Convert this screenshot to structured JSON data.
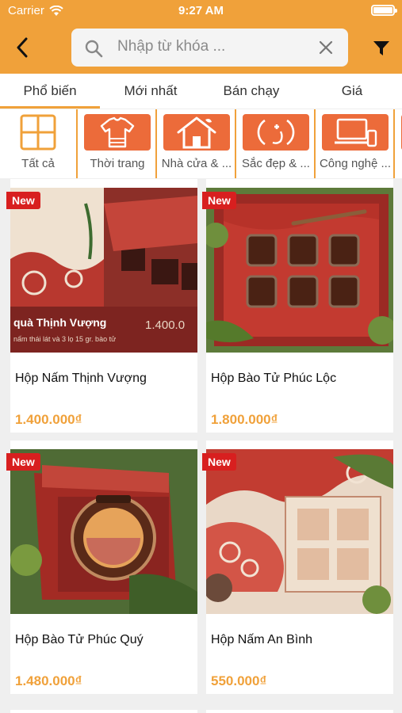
{
  "status_bar": {
    "carrier": "Carrier",
    "time": "9:27 AM"
  },
  "header": {
    "search_placeholder": "Nhập từ khóa ...",
    "accent": "#f0a13a"
  },
  "tabs": [
    {
      "label": "Phổ biến",
      "active": true
    },
    {
      "label": "Mới nhất",
      "active": false
    },
    {
      "label": "Bán chạy",
      "active": false
    },
    {
      "label": "Giá",
      "active": false
    }
  ],
  "categories": [
    {
      "label": "Tất cả",
      "icon": "grid-icon"
    },
    {
      "label": "Thời trang",
      "icon": "shirt-icon"
    },
    {
      "label": "Nhà cửa & ...",
      "icon": "house-icon"
    },
    {
      "label": "Sắc đẹp & ...",
      "icon": "beauty-icon"
    },
    {
      "label": "Công nghệ ...",
      "icon": "devices-icon"
    }
  ],
  "products": [
    {
      "badge": "New",
      "name": "Hộp Nấm Thịnh Vượng",
      "price": "1.400.000₫",
      "img_caption": "quà Thịnh Vượng",
      "img_price": "1.400.0",
      "img_sub": "nấm thái lát và 3 lọ 15 gr. bào tử"
    },
    {
      "badge": "New",
      "name": "Hộp Bào Tử Phúc Lộc",
      "price": "1.800.000₫"
    },
    {
      "badge": "New",
      "name": "Hộp Bào Tử Phúc Quý",
      "price": "1.480.000₫"
    },
    {
      "badge": "New",
      "name": "Hộp Nấm An Bình",
      "price": "550.000₫"
    }
  ]
}
